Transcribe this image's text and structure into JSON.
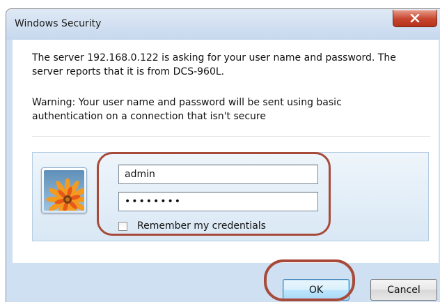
{
  "window": {
    "title": "Windows Security",
    "close_icon": "close-x-icon",
    "close_color": "#c7442d"
  },
  "message": {
    "line1": "The server 192.168.0.122 is asking for your user name and password. The",
    "line2": "server reports that it is from DCS-960L.",
    "warning1": "Warning: Your user name and password will be sent using basic",
    "warning2": "authentication on a connection that isn't secure"
  },
  "credentials": {
    "avatar_icon": "flower-user-tile-icon",
    "username_value": "admin",
    "password_value": "••••••••",
    "remember_label": "Remember my credentials",
    "remember_checked": false
  },
  "buttons": {
    "ok_label": "OK",
    "cancel_label": "Cancel"
  },
  "annotations": {
    "highlight_color": "#a74a3a"
  }
}
